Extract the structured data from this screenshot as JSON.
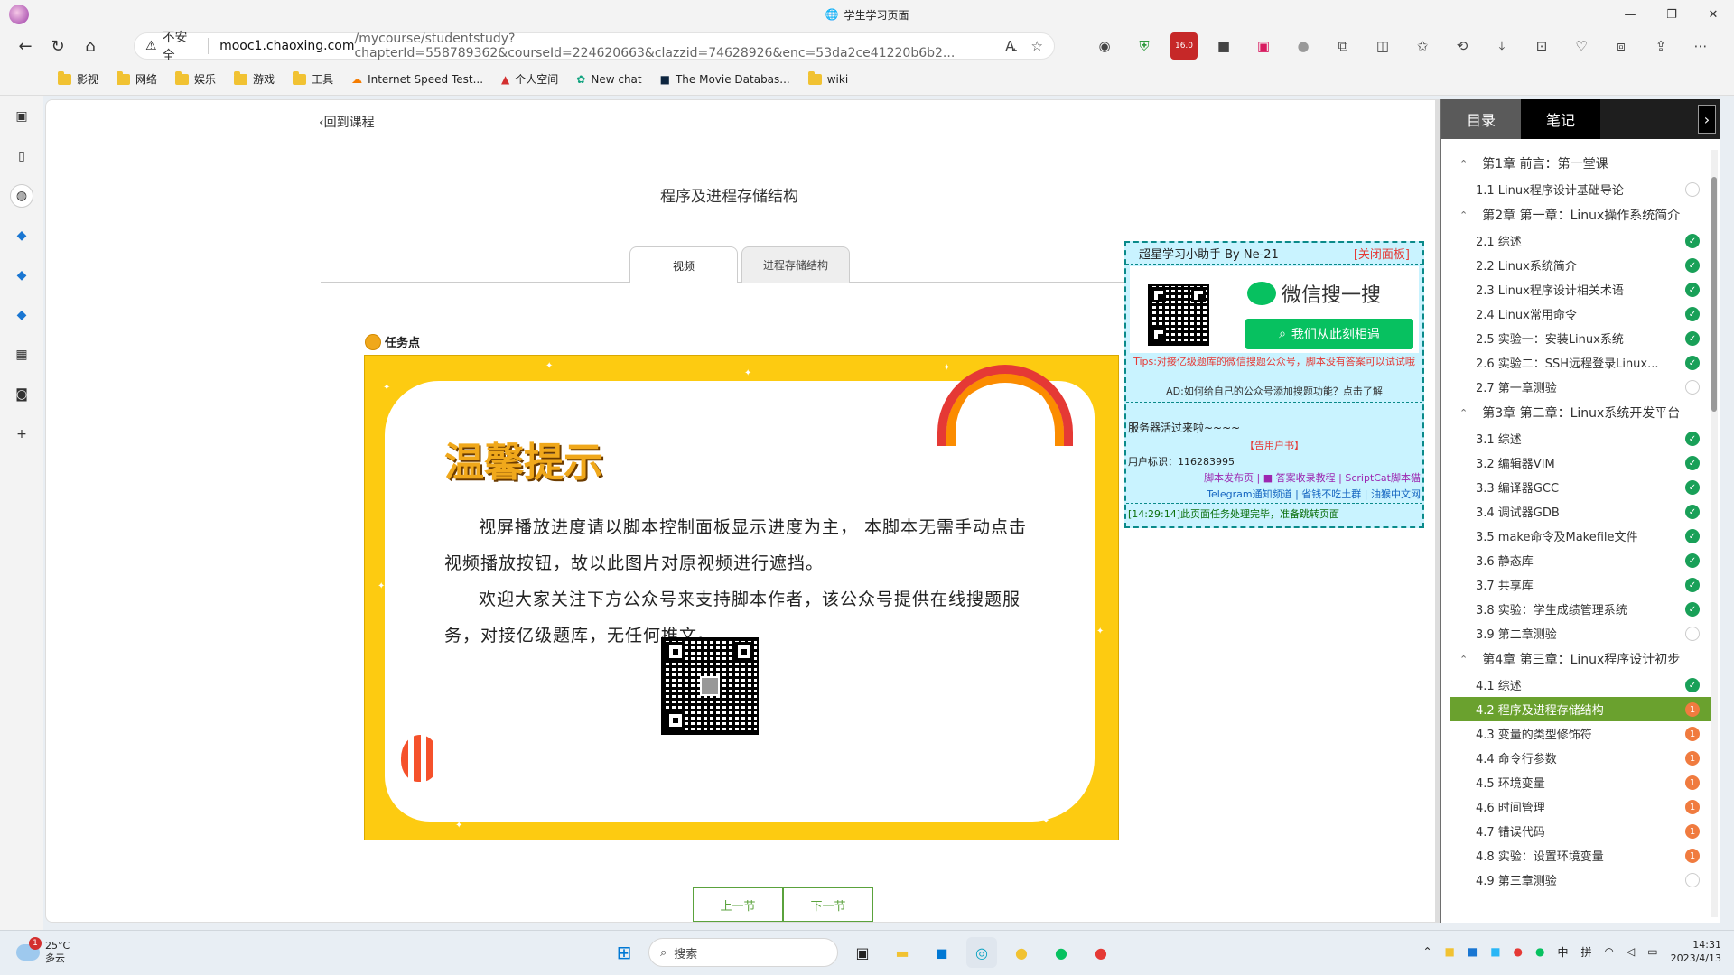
{
  "browser": {
    "tab_title": "学生学习页面",
    "security_label": "不安全",
    "url_host": "mooc1.chaoxing.com",
    "url_path": "/mycourse/studentstudy?chapterId=558789362&courseId=224620663&clazzid=74628926&enc=53da2ce41220b6b2...",
    "ext_badge": "16.0"
  },
  "bookmarks": [
    "影视",
    "网络",
    "娱乐",
    "游戏",
    "工具",
    "Internet Speed Test...",
    "个人空间",
    "New chat",
    "The Movie Databas...",
    "wiki"
  ],
  "page": {
    "back_label": "回到课程",
    "course_title": "程序及进程存储结构",
    "tabs": [
      "视频",
      "进程存储结构"
    ],
    "task_point_label": "任务点",
    "poster": {
      "title": "温馨提示",
      "para1": "视屏播放进度请以脚本控制面板显示进度为主， 本脚本无需手动点击视频播放按钮，故以此图片对原视频进行遮挡。",
      "para2": "欢迎大家关注下方公众号来支持脚本作者，该公众号提供在线搜题服务，对接亿级题库，无任何推文。"
    },
    "prev_label": "上一节",
    "next_label": "下一节"
  },
  "helper": {
    "title": "超星学习小助手 By Ne-21",
    "close_label": "[关闭面板]",
    "wechat_text": "微信搜一搜",
    "green_button": "我们从此刻相遇",
    "tips": "Tips:对接亿级题库的微信搜题公众号，脚本没有答案可以试试哦",
    "ad": "AD:如何给自己的公众号添加搜题功能？点击了解",
    "server": "服务器活过来啦~~~~",
    "manual": "【告用户书】",
    "user_id": "用户标识：116283995",
    "links_row1": "脚本发布页 | ■ 答案收录教程 | ScriptCat脚本猫",
    "links_row2": "Telegram通知频道 | 省钱不吃土群 | 油猴中文网",
    "log": "[14:29:14]此页面任务处理完毕，准备跳转页面"
  },
  "sidebar": {
    "tab_dir": "目录",
    "tab_note": "笔记",
    "chapters": [
      {
        "title": "第1章 前言：第一堂课",
        "items": [
          {
            "label": "1.1 Linux程序设计基础导论",
            "status": "none"
          }
        ]
      },
      {
        "title": "第2章 第一章：Linux操作系统简介",
        "items": [
          {
            "label": "2.1 综述",
            "status": "done"
          },
          {
            "label": "2.2 Linux系统简介",
            "status": "done"
          },
          {
            "label": "2.3 Linux程序设计相关术语",
            "status": "done"
          },
          {
            "label": "2.4 Linux常用命令",
            "status": "done"
          },
          {
            "label": "2.5 实验一：安装Linux系统",
            "status": "done"
          },
          {
            "label": "2.6 实验二：SSH远程登录Linux...",
            "status": "done"
          },
          {
            "label": "2.7 第一章测验",
            "status": "none"
          }
        ]
      },
      {
        "title": "第3章 第二章：Linux系统开发平台",
        "items": [
          {
            "label": "3.1 综述",
            "status": "done"
          },
          {
            "label": "3.2 编辑器VIM",
            "status": "done"
          },
          {
            "label": "3.3 编译器GCC",
            "status": "done"
          },
          {
            "label": "3.4 调试器GDB",
            "status": "done"
          },
          {
            "label": "3.5 make命令及Makefile文件",
            "status": "done"
          },
          {
            "label": "3.6 静态库",
            "status": "done"
          },
          {
            "label": "3.7 共享库",
            "status": "done"
          },
          {
            "label": "3.8 实验：学生成绩管理系统",
            "status": "done"
          },
          {
            "label": "3.9 第二章测验",
            "status": "none"
          }
        ]
      },
      {
        "title": "第4章 第三章：Linux程序设计初步",
        "items": [
          {
            "label": "4.1 综述",
            "status": "done"
          },
          {
            "label": "4.2 程序及进程存储结构",
            "status": "todo",
            "active": true
          },
          {
            "label": "4.3 变量的类型修饰符",
            "status": "todo"
          },
          {
            "label": "4.4 命令行参数",
            "status": "todo"
          },
          {
            "label": "4.5 环境变量",
            "status": "todo"
          },
          {
            "label": "4.6 时间管理",
            "status": "todo"
          },
          {
            "label": "4.7 错误代码",
            "status": "todo"
          },
          {
            "label": "4.8 实验：设置环境变量",
            "status": "todo"
          },
          {
            "label": "4.9 第三章测验",
            "status": "none"
          }
        ]
      }
    ],
    "todo_badge": "1"
  },
  "taskbar": {
    "temp": "25°C",
    "weather": "多云",
    "weather_badge": "1",
    "search_label": "搜索",
    "ime1": "中",
    "ime2": "拼",
    "time": "14:31",
    "date": "2023/4/13"
  }
}
